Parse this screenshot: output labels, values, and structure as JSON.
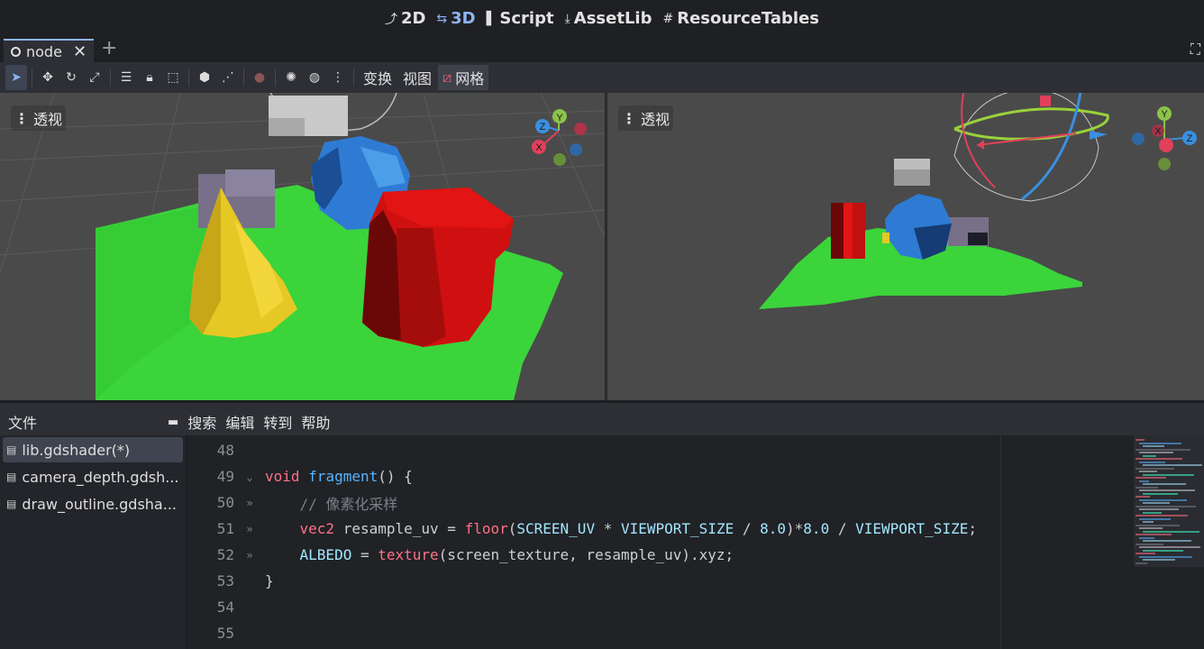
{
  "topbar": {
    "modes": [
      {
        "icon": "2d-icon",
        "glyph": "⤴",
        "label": "2D"
      },
      {
        "icon": "3d-icon",
        "glyph": "⇆",
        "label": "3D"
      },
      {
        "icon": "script-icon",
        "glyph": "▌",
        "label": "Script"
      },
      {
        "icon": "assetlib-icon",
        "glyph": "⤓",
        "label": "AssetLib"
      },
      {
        "icon": "resourcetables-icon",
        "glyph": "#",
        "label": "ResourceTables"
      }
    ],
    "active_mode": "3D",
    "active_color": "#8eb4f2"
  },
  "scene_tabs": {
    "tab_label": "node",
    "close_glyph": "✕",
    "add_glyph": "+"
  },
  "toolbar": {
    "tools": [
      "select-icon",
      "move-icon",
      "rotate-icon",
      "scale-icon",
      "list-select-icon",
      "lock-icon",
      "group-icon",
      "local-space-icon",
      "snap-icon",
      "camera-icon",
      "sun-icon",
      "environment-icon",
      "more-icon"
    ],
    "menus": {
      "transform": "变换",
      "view": "视图",
      "grid": "网格"
    }
  },
  "viewports": {
    "left": {
      "perspective_label": "透视"
    },
    "right": {
      "perspective_label": "透视"
    },
    "gizmo_axes": {
      "x": "X",
      "y": "Y",
      "z": "Z"
    },
    "colors": {
      "ground": "#3bd43b",
      "sphere": "#2f7bd4",
      "cylinder": "#d01010",
      "cone": "#e6c825",
      "box": "#777088",
      "background": "#4a4a4a"
    }
  },
  "bottom_panel": {
    "files_label": "文件",
    "menu": {
      "search": "搜索",
      "edit": "编辑",
      "goto": "转到",
      "help": "帮助"
    },
    "files": [
      "lib.gdshader(*)",
      "camera_depth.gdsh...",
      "draw_outline.gdsha..."
    ],
    "selected_file_index": 0
  },
  "editor": {
    "lines": [
      {
        "num": "48",
        "fold": "",
        "tokens": []
      },
      {
        "num": "49",
        "fold": "⌄",
        "tokens": [
          {
            "t": "void",
            "c": "kw"
          },
          {
            "t": " ",
            "c": "op"
          },
          {
            "t": "fragment",
            "c": "fn"
          },
          {
            "t": "() {",
            "c": "op"
          }
        ]
      },
      {
        "num": "50",
        "fold": "»",
        "tokens": [
          {
            "t": "    ",
            "c": "op"
          },
          {
            "t": "// 像素化采样",
            "c": "cm"
          }
        ]
      },
      {
        "num": "51",
        "fold": "»",
        "tokens": [
          {
            "t": "    ",
            "c": "op"
          },
          {
            "t": "vec2",
            "c": "kw"
          },
          {
            "t": " resample_uv = ",
            "c": "op"
          },
          {
            "t": "floor",
            "c": "kw"
          },
          {
            "t": "(",
            "c": "op"
          },
          {
            "t": "SCREEN_UV",
            "c": "bi"
          },
          {
            "t": " * ",
            "c": "op"
          },
          {
            "t": "VIEWPORT_SIZE",
            "c": "bi"
          },
          {
            "t": " / ",
            "c": "op"
          },
          {
            "t": "8.0",
            "c": "bi"
          },
          {
            "t": ")*",
            "c": "op"
          },
          {
            "t": "8.0",
            "c": "bi"
          },
          {
            "t": " / ",
            "c": "op"
          },
          {
            "t": "VIEWPORT_SIZE",
            "c": "bi"
          },
          {
            "t": ";",
            "c": "op"
          }
        ]
      },
      {
        "num": "52",
        "fold": "»",
        "tokens": [
          {
            "t": "    ",
            "c": "op"
          },
          {
            "t": "ALBEDO",
            "c": "bi"
          },
          {
            "t": " = ",
            "c": "op"
          },
          {
            "t": "texture",
            "c": "kw"
          },
          {
            "t": "(screen_texture, resample_uv).xyz;",
            "c": "op"
          }
        ]
      },
      {
        "num": "53",
        "fold": "",
        "tokens": [
          {
            "t": "}",
            "c": "op"
          }
        ]
      },
      {
        "num": "54",
        "fold": "",
        "tokens": []
      },
      {
        "num": "55",
        "fold": "",
        "tokens": []
      }
    ]
  }
}
